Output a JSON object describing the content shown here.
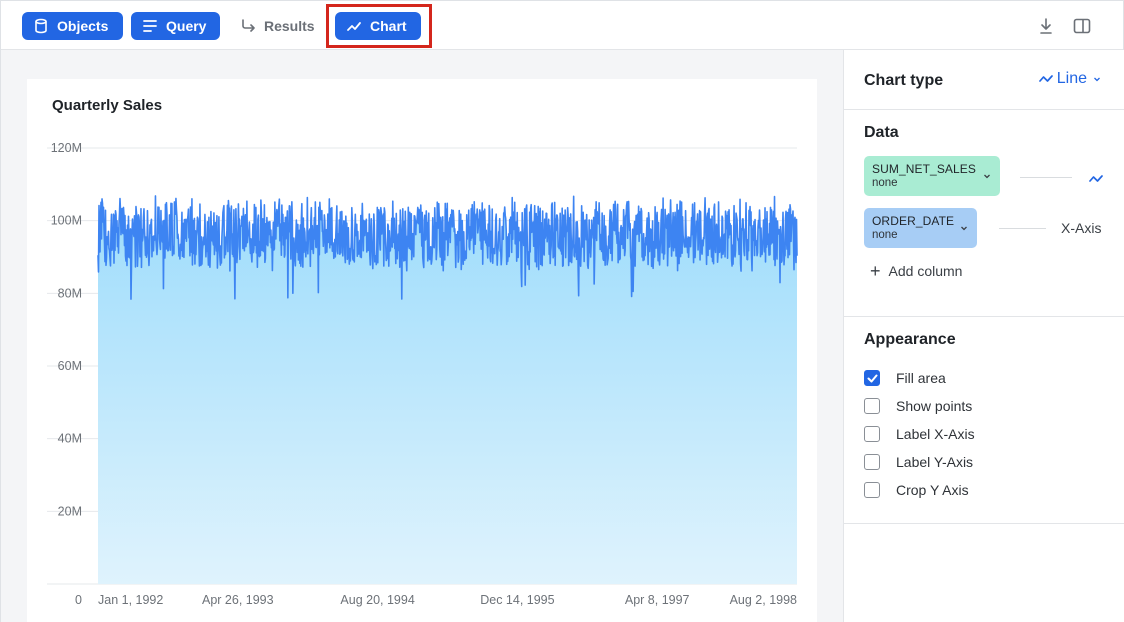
{
  "toolbar": {
    "objects_label": "Objects",
    "query_label": "Query",
    "results_label": "Results",
    "chart_label": "Chart",
    "download_icon": "download-icon",
    "split_icon": "split-view-icon"
  },
  "chart": {
    "title": "Quarterly Sales"
  },
  "chart_data": {
    "type": "area",
    "title": "Quarterly Sales",
    "xlabel": "",
    "ylabel": "",
    "ylim": [
      0,
      120000000
    ],
    "y_ticks": [
      "0",
      "20M",
      "40M",
      "60M",
      "80M",
      "100M",
      "120M"
    ],
    "y_tick_values": [
      0,
      20000000,
      40000000,
      60000000,
      80000000,
      100000000,
      120000000
    ],
    "x_tick_labels": [
      "Jan 1, 1992",
      "Apr 26, 1993",
      "Aug 20, 1994",
      "Dec 14, 1995",
      "Apr 8, 1997",
      "Aug 2, 1998"
    ],
    "x_range": [
      "1992-01-01",
      "1998-08-02"
    ],
    "grid": true,
    "fill_area": true,
    "series": [
      {
        "approx_mean": 96000000,
        "approx_min": 77000000,
        "approx_max": 107000000,
        "note": "daily values oscillating roughly between 88M and 105M with occasional dips near 77M"
      }
    ]
  },
  "panel": {
    "chart_type_label": "Chart type",
    "chart_type_value": "Line",
    "data_title": "Data",
    "fields": [
      {
        "name": "SUM_NET_SALES",
        "sub": "none",
        "role": ""
      },
      {
        "name": "ORDER_DATE",
        "sub": "none",
        "role": "X-Axis"
      }
    ],
    "add_column_label": "Add column",
    "appearance_title": "Appearance",
    "options": [
      {
        "label": "Fill area",
        "checked": true
      },
      {
        "label": "Show points",
        "checked": false
      },
      {
        "label": "Label X-Axis",
        "checked": false
      },
      {
        "label": "Label Y-Axis",
        "checked": false
      },
      {
        "label": "Crop Y Axis",
        "checked": false
      }
    ]
  },
  "colors": {
    "accent": "#2266e3",
    "line": "#3d84f2",
    "fill_top": "#9ddcfb",
    "fill_bottom": "#dff3fd",
    "highlight": "#d4261c"
  }
}
